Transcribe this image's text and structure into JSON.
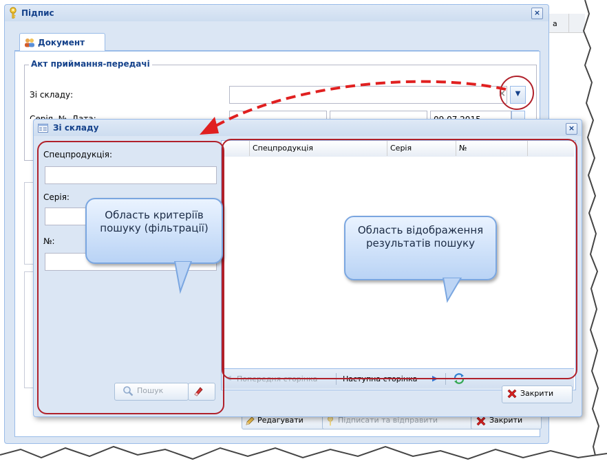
{
  "colors": {
    "accent": "#15428b",
    "border": "#99bbe8",
    "highlight": "#b0202a",
    "arrow": "#e02020"
  },
  "main_window": {
    "title": "Підпис",
    "tab_label": "Документ",
    "fieldset_legend": "Акт приймання-передачі",
    "label_from_warehouse": "Зі складу:",
    "label_series_date": "Серія, №, Дата:",
    "date_value": "09.07.2015",
    "buttons": {
      "edit": "Редагувати",
      "sign_send": "Підписати та відправити",
      "close": "Закрити"
    },
    "right_col_fragment": "а"
  },
  "lookup_window": {
    "title": "Зі складу",
    "filter": {
      "label_product": "Спецпродукція:",
      "label_series": "Серія:",
      "label_number": "№:",
      "search_button": "Пошук"
    },
    "grid": {
      "columns": [
        "Спецпродукція",
        "Серія",
        "№"
      ]
    },
    "pager": {
      "prev": "Попередня сторінка",
      "next": "Наступна сторінка"
    },
    "close_button": "Закрити"
  },
  "callouts": {
    "filter_area": "Область критеріїв пошуку (фільтрації)",
    "results_area": "Область відображення результатів пошуку"
  }
}
